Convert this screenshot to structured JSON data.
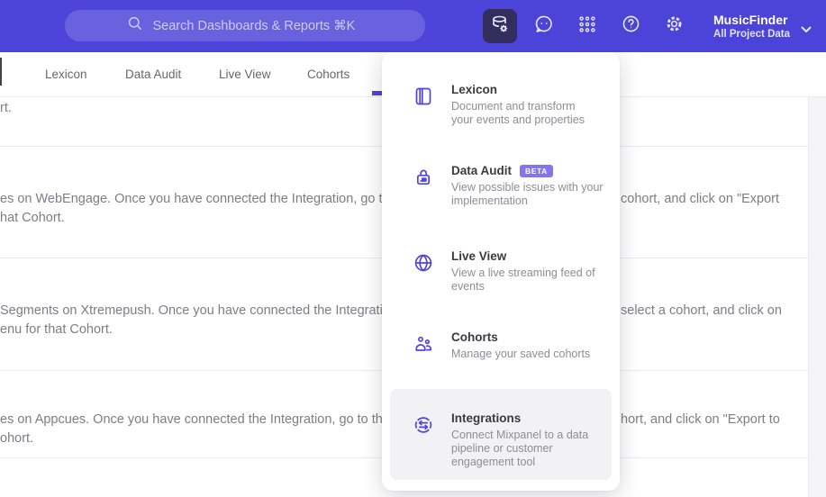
{
  "header": {
    "search_placeholder": "Search Dashboards & Reports ⌘K",
    "project_name": "MusicFinder",
    "project_scope": "All Project Data"
  },
  "tabs": {
    "items": [
      "Lexicon",
      "Data Audit",
      "Live View",
      "Cohorts"
    ]
  },
  "menu": {
    "items": [
      {
        "title": "Lexicon",
        "icon": "book-icon",
        "description_lines": [
          "Document and transform",
          "your events and properties"
        ]
      },
      {
        "title": "Data Audit",
        "icon": "lock-audit-icon",
        "badge": "BETA",
        "description_lines": [
          "View possible issues with your",
          "implementation"
        ]
      },
      {
        "title": "Live View",
        "icon": "globe-icon",
        "description_lines": [
          "View a live streaming feed of",
          "events"
        ]
      },
      {
        "title": "Cohorts",
        "icon": "people-icon",
        "description_lines": [
          "Manage your saved cohorts"
        ]
      },
      {
        "title": "Integrations",
        "icon": "sync-arrows-icon",
        "description_lines": [
          "Connect Mixpanel to a data",
          "pipeline or customer",
          "engagement tool"
        ]
      }
    ]
  },
  "background": {
    "row1_left": "rt.",
    "row2_left1": "es on WebEngage. Once you have connected the Integration, go to the",
    "row2_left2": "hat Cohort.",
    "row2_right1": "cohort, and click on \"Export",
    "row3_left1": "Segments on Xtremepush. Once you have connected the Integration,",
    "row3_left2": "enu for that Cohort.",
    "row3_right1": "select a cohort, and click on",
    "row4_left1": "es on Appcues. Once you have connected the Integration, go to the M",
    "row4_left2": "ohort.",
    "row4_right1": "hort, and click on \"Export to"
  },
  "colors": {
    "header_bg": "#4c44d9",
    "accent": "#4f44e0",
    "beta_badge_bg": "#8375ec",
    "menu_highlight_bg": "#f2f2f4"
  }
}
